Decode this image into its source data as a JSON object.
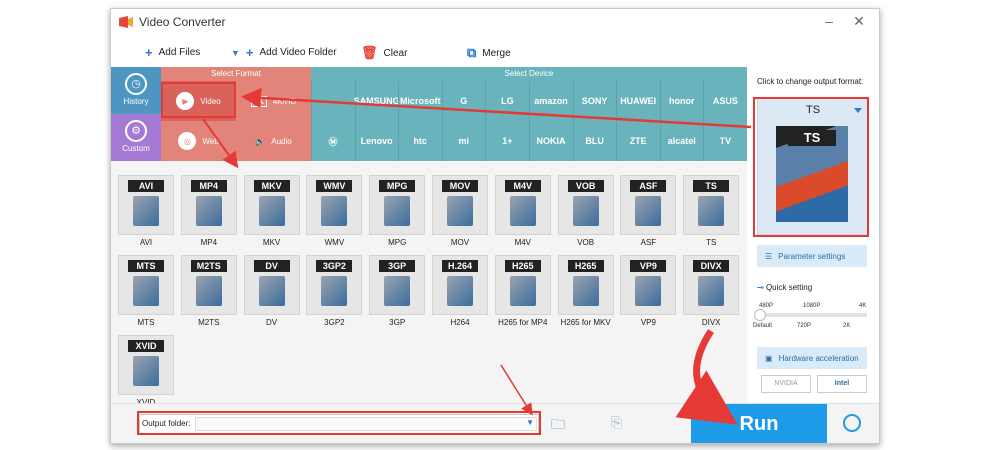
{
  "window": {
    "title": "Video Converter",
    "minimize": "–",
    "close": "✕"
  },
  "toolbar": {
    "add_files": "Add Files",
    "add_video_folder": "Add Video Folder",
    "clear": "Clear",
    "merge": "Merge"
  },
  "sidebar": {
    "history": "History",
    "custom": "Custom"
  },
  "format_panel": {
    "heading": "Select Format",
    "buttons": [
      {
        "label": "Video"
      },
      {
        "label": "4K/HD",
        "badge": "4K"
      },
      {
        "label": "Web"
      },
      {
        "label": "Audio"
      }
    ]
  },
  "device_panel": {
    "heading": "Select Device",
    "row1": [
      "",
      "SAMSUNG",
      "Microsoft",
      "G",
      "LG",
      "amazon",
      "SONY",
      "HUAWEI",
      "honor",
      "ASUS"
    ],
    "row2": [
      "",
      "Lenovo",
      "htc",
      "mi",
      "1+",
      "NOKIA",
      "BLU",
      "ZTE",
      "alcatel",
      "TV"
    ]
  },
  "formats": [
    {
      "tag": "AVI",
      "label": "AVI"
    },
    {
      "tag": "MP4",
      "label": "MP4"
    },
    {
      "tag": "MKV",
      "label": "MKV"
    },
    {
      "tag": "WMV",
      "label": "WMV"
    },
    {
      "tag": "MPG",
      "label": "MPG"
    },
    {
      "tag": "MOV",
      "label": "MOV"
    },
    {
      "tag": "M4V",
      "label": "M4V"
    },
    {
      "tag": "VOB",
      "label": "VOB"
    },
    {
      "tag": "ASF",
      "label": "ASF"
    },
    {
      "tag": "TS",
      "label": "TS"
    },
    {
      "tag": "MTS",
      "label": "MTS"
    },
    {
      "tag": "M2TS",
      "label": "M2TS"
    },
    {
      "tag": "DV",
      "label": "DV"
    },
    {
      "tag": "3GP2",
      "label": "3GP2"
    },
    {
      "tag": "3GP",
      "label": "3GP"
    },
    {
      "tag": "H.264",
      "label": "H264"
    },
    {
      "tag": "H265",
      "label": "H265 for MP4"
    },
    {
      "tag": "H265",
      "label": "H265 for MKV"
    },
    {
      "tag": "VP9",
      "label": "VP9"
    },
    {
      "tag": "DIVX",
      "label": "DIVX"
    },
    {
      "tag": "XVID",
      "label": "XVID"
    }
  ],
  "output": {
    "label": "Output folder:"
  },
  "run_label": "Run",
  "right_panel": {
    "caption": "Click to change output format:",
    "selected_format": "TS",
    "preview_tag": "TS",
    "parameter_settings": "Parameter settings",
    "quick_setting": "Quick setting",
    "slider_top": [
      "480P",
      "1080P",
      "4K"
    ],
    "slider_bottom": [
      "Default",
      "720P",
      "2K"
    ],
    "slider_value": 0,
    "hardware_acceleration": "Hardware acceleration",
    "gpu_nvidia": "NVIDIA",
    "gpu_intel": "Intel"
  },
  "colors": {
    "accent": "#1e9be8",
    "format_panel": "#e3847a",
    "device_panel": "#69b4bc",
    "history": "#4e95c2",
    "custom": "#a57ad4",
    "annotation": "#e53935"
  }
}
